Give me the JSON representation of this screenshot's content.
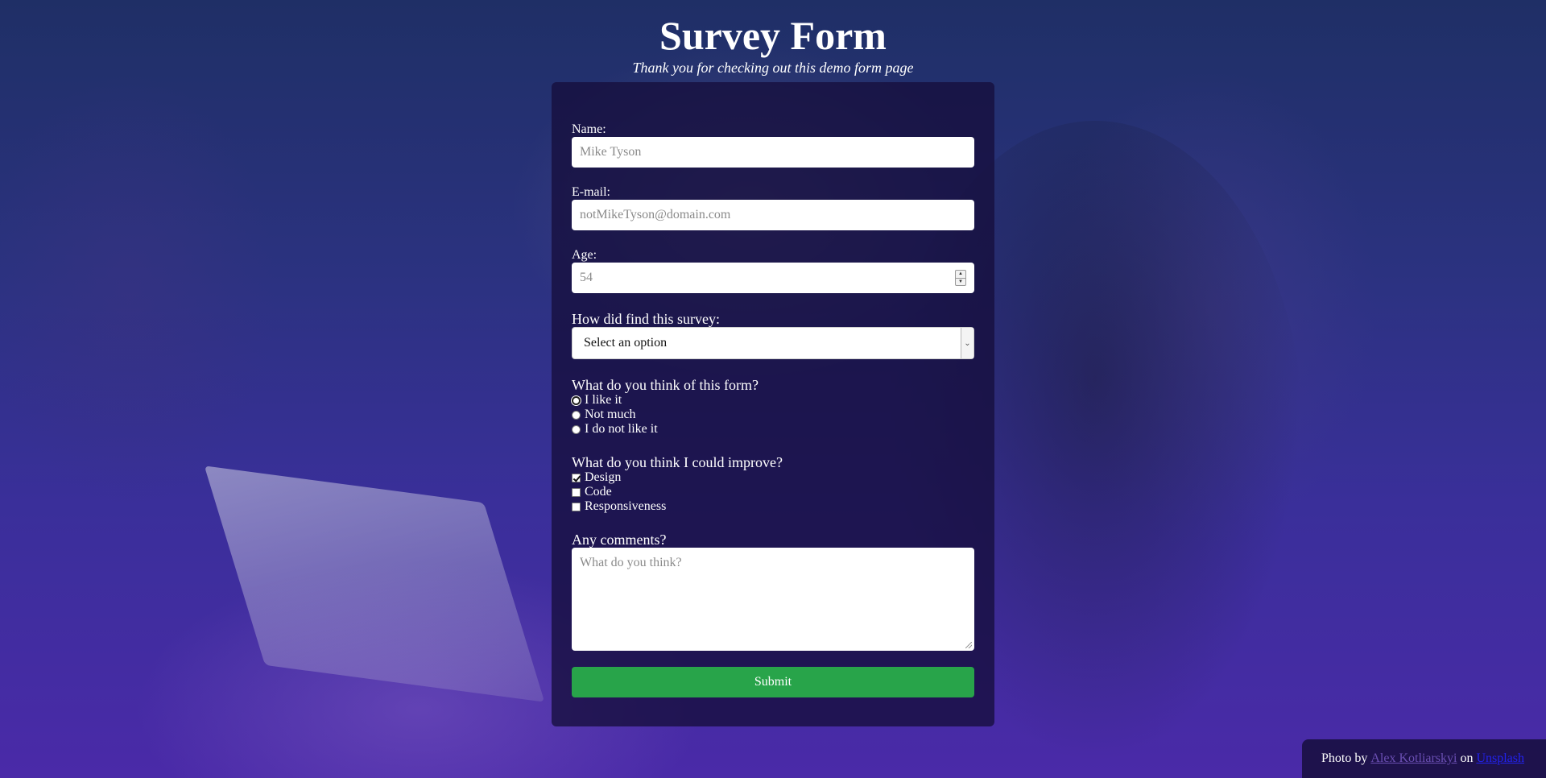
{
  "header": {
    "title": "Survey Form",
    "subtitle": "Thank you for checking out this demo form page"
  },
  "form": {
    "name": {
      "label": "Name:",
      "placeholder": "Mike Tyson"
    },
    "email": {
      "label": "E-mail:",
      "placeholder": "notMikeTyson@domain.com"
    },
    "age": {
      "label": "Age:",
      "placeholder": "54"
    },
    "source": {
      "label": "How did find this survey:",
      "selected": "Select an option"
    },
    "opinion": {
      "label": "What do you think of this form?",
      "options": [
        {
          "label": "I like it",
          "checked": true
        },
        {
          "label": "Not much",
          "checked": false
        },
        {
          "label": "I do not like it",
          "checked": false
        }
      ]
    },
    "improve": {
      "label": "What do you think I could improve?",
      "options": [
        {
          "label": "Design",
          "checked": true
        },
        {
          "label": "Code",
          "checked": false
        },
        {
          "label": "Responsiveness",
          "checked": false
        }
      ]
    },
    "comments": {
      "label": "Any comments?",
      "placeholder": "What do you think?"
    },
    "submit_label": "Submit"
  },
  "credit": {
    "prefix": "Photo by",
    "author": "Alex Kotliarskyi",
    "middle": "on",
    "site": "Unsplash"
  },
  "colors": {
    "submit": "#28a44a",
    "card": "#160e3c"
  }
}
